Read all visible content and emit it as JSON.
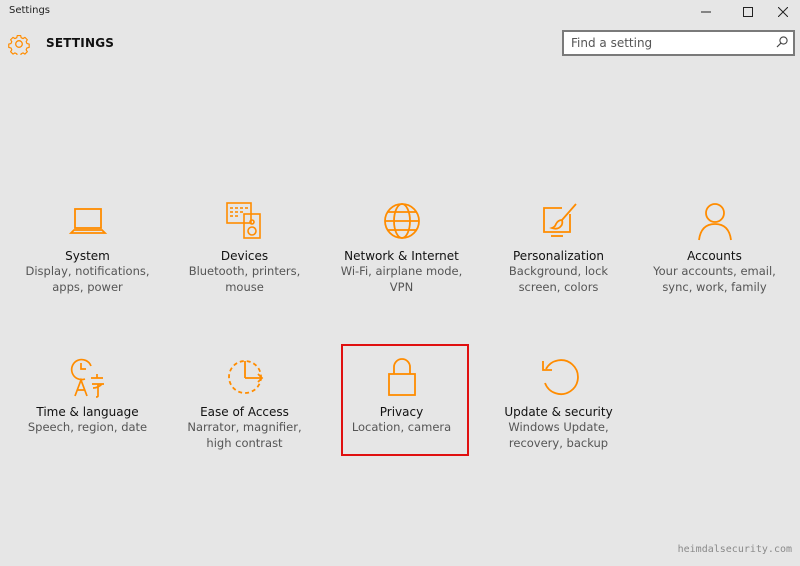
{
  "window": {
    "title": "Settings",
    "controls": {
      "minimize": "–",
      "maximize": "☐",
      "close": "✕"
    }
  },
  "header": {
    "title": "SETTINGS",
    "search_placeholder": "Find a setting"
  },
  "accent_color": "#ff8c00",
  "tiles": [
    {
      "name": "System",
      "description": "Display, notifications, apps, power",
      "icon": "laptop-icon"
    },
    {
      "name": "Devices",
      "description": "Bluetooth, printers, mouse",
      "icon": "keyboard-speaker-icon"
    },
    {
      "name": "Network & Internet",
      "description": "Wi-Fi, airplane mode, VPN",
      "icon": "globe-icon"
    },
    {
      "name": "Personalization",
      "description": "Background, lock screen, colors",
      "icon": "paint-icon"
    },
    {
      "name": "Accounts",
      "description": "Your accounts, email, sync, work, family",
      "icon": "person-icon"
    },
    {
      "name": "Time & language",
      "description": "Speech, region, date",
      "icon": "clock-language-icon"
    },
    {
      "name": "Ease of Access",
      "description": "Narrator, magnifier, high contrast",
      "icon": "ease-of-access-icon"
    },
    {
      "name": "Privacy",
      "description": "Location, camera",
      "icon": "lock-icon"
    },
    {
      "name": "Update & security",
      "description": "Windows Update, recovery, backup",
      "icon": "refresh-icon"
    }
  ],
  "highlighted_tile": "Privacy",
  "watermark": "heimdalsecurity.com"
}
